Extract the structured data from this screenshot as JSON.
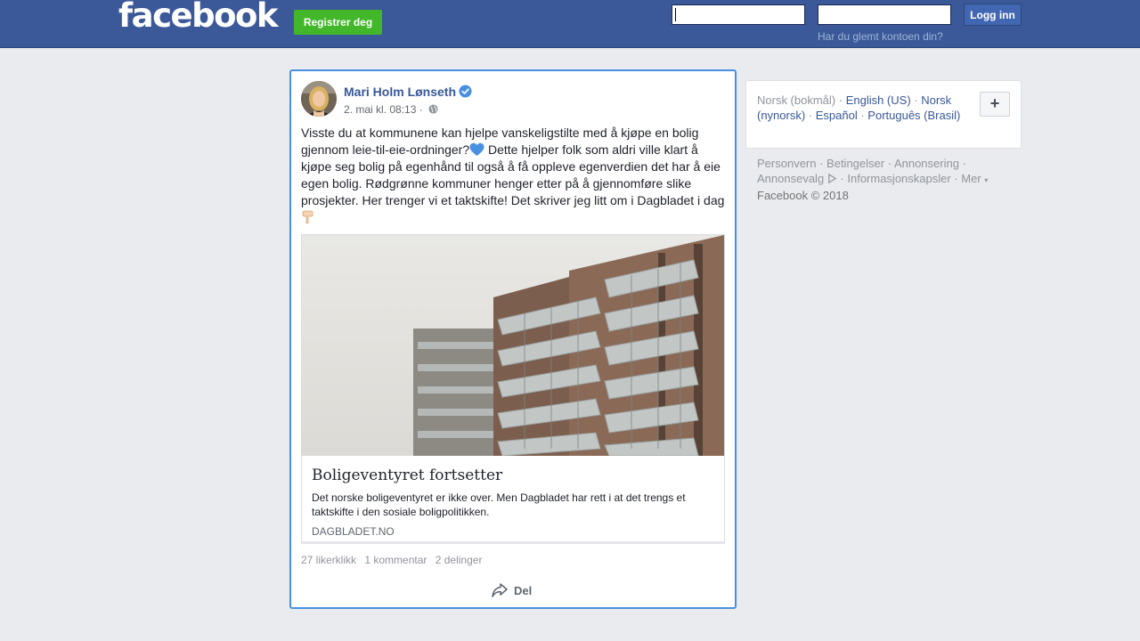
{
  "header": {
    "logo": "facebook",
    "register_label": "Registrer deg",
    "email_value": "",
    "password_value": "",
    "login_label": "Logg inn",
    "forgot_label": "Har du glemt kontoen din?"
  },
  "post": {
    "author": "Mari Holm Lønseth",
    "timestamp": "2. mai kl. 08:13",
    "meta_separator": "·",
    "text_part1": "Visste du at kommunene kan hjelpe vanskeligstilte med å kjøpe en bolig gjennom leie-til-eie-ordninger?",
    "text_part2": " Dette hjelper folk som aldri ville klart å kjøpe seg bolig på egenhånd til også å få oppleve egenverdien det har å eie egen bolig. Rødgrønne kommuner henger etter på å gjennomføre slike prosjekter. Her trenger vi et taktskifte! Det skriver jeg litt om i Dagbladet i dag",
    "emoji_heart": "blue-heart-icon",
    "emoji_point": "pointing-down-icon",
    "link": {
      "title": "Boligeventyret fortsetter",
      "description": "Det norske boligeventyret er ikke over. Men Dagbladet har rett i at det trengs et taktskifte i den sosiale boligpolitikken.",
      "domain": "DAGBLADET.NO"
    },
    "stats": {
      "likes": "27 likerklikk",
      "comments": "1 kommentar",
      "shares": "2 delinger"
    },
    "share_label": "Del"
  },
  "languages": {
    "current": "Norsk (bokmål)",
    "items": [
      "English (US)",
      "Norsk (nynorsk)",
      "Español",
      "Português (Brasil)"
    ],
    "plus_label": "+"
  },
  "footer": {
    "links": [
      "Personvern",
      "Betingelser",
      "Annonsering",
      "Annonsevalg",
      "Informasjonskapsler",
      "Mer"
    ],
    "copyright": "Facebook © 2018"
  },
  "colors": {
    "brand": "#3b5998",
    "register_green": "#42b72a",
    "link_blue": "#385898",
    "focus_border": "#4a90e2"
  }
}
